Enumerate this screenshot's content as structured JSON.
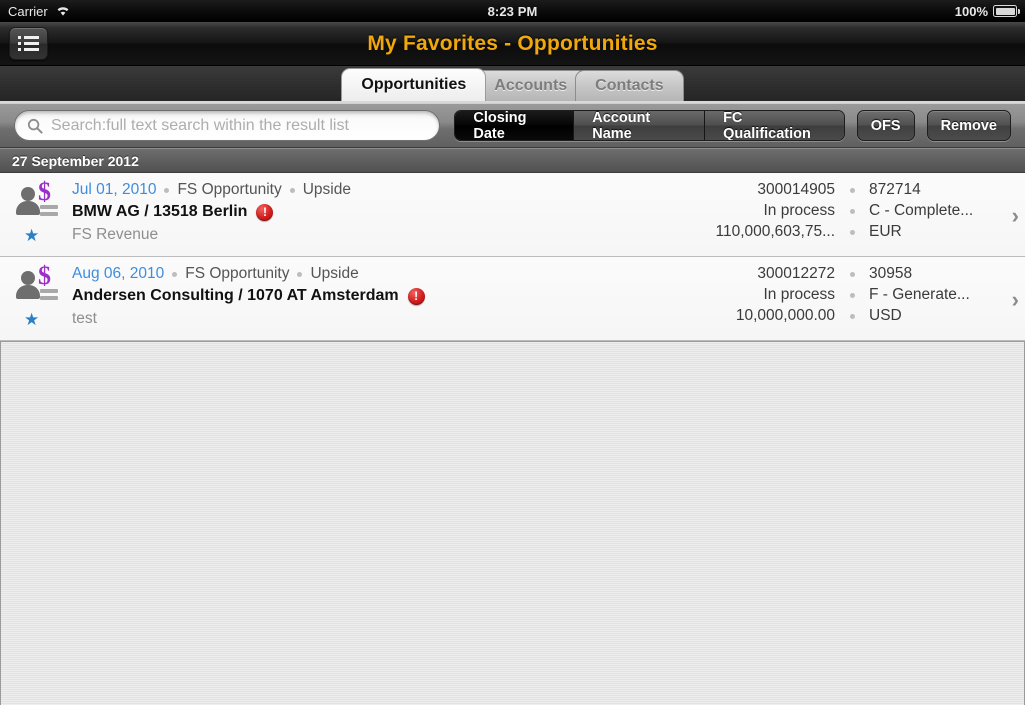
{
  "status_bar": {
    "carrier": "Carrier",
    "wifi_icon": "wifi-icon",
    "time": "8:23 PM",
    "battery_percent": "100%",
    "battery_icon": "battery-full-icon"
  },
  "title_bar": {
    "menu_icon": "bulleted-list-icon",
    "title": "My Favorites - Opportunities",
    "title_color": "#f0a80c"
  },
  "tabs": [
    {
      "label": "Opportunities",
      "active": true
    },
    {
      "label": "Accounts",
      "active": false
    },
    {
      "label": "Contacts",
      "active": false
    }
  ],
  "toolbar": {
    "search_icon": "search-icon",
    "search_value": "",
    "search_placeholder": "Search:full text search within the result list",
    "segments": [
      {
        "label": "Closing Date",
        "selected": true
      },
      {
        "label": "Account Name",
        "selected": false
      },
      {
        "label": "FC Qualification",
        "selected": false
      }
    ],
    "ofs_button": "OFS",
    "remove_button": "Remove"
  },
  "section_header": {
    "date": "27 September 2012"
  },
  "rows": [
    {
      "icons": {
        "avatar_icon": "person-icon",
        "currency_icon": "dollar-sign-icon",
        "lines_icon": "lines-icon",
        "favorite_icon": "star-icon"
      },
      "date": "Jul 01, 2010",
      "type": "FS Opportunity",
      "category": "Upside",
      "title": "BMW AG / 13518 Berlin",
      "alert_icon": "alert-exclamation-icon",
      "alert_glyph": "!",
      "subtitle": "FS Revenue",
      "id_number": "300014905",
      "secondary_id": "872714",
      "status": "In process",
      "qualification": "C - Complete...",
      "amount": "110,000,603,75...",
      "currency": "EUR",
      "chevron_icon": "chevron-right-icon"
    },
    {
      "icons": {
        "avatar_icon": "person-icon",
        "currency_icon": "dollar-sign-icon",
        "lines_icon": "lines-icon",
        "favorite_icon": "star-icon"
      },
      "date": "Aug 06, 2010",
      "type": "FS Opportunity",
      "category": "Upside",
      "title": "Andersen Consulting / 1070 AT Amsterdam",
      "alert_icon": "alert-exclamation-icon",
      "alert_glyph": "!",
      "subtitle": "test",
      "id_number": "300012272",
      "secondary_id": "30958",
      "status": "In process",
      "qualification": "F - Generate...",
      "amount": "10,000,000.00",
      "currency": "USD",
      "chevron_icon": "chevron-right-icon"
    }
  ],
  "colors": {
    "accent_orange": "#f0a80c",
    "link_blue": "#3d8ddf",
    "star_blue": "#2a7fc9",
    "dollar_purple": "#9b30c8",
    "alert_red": "#d31d1d"
  }
}
